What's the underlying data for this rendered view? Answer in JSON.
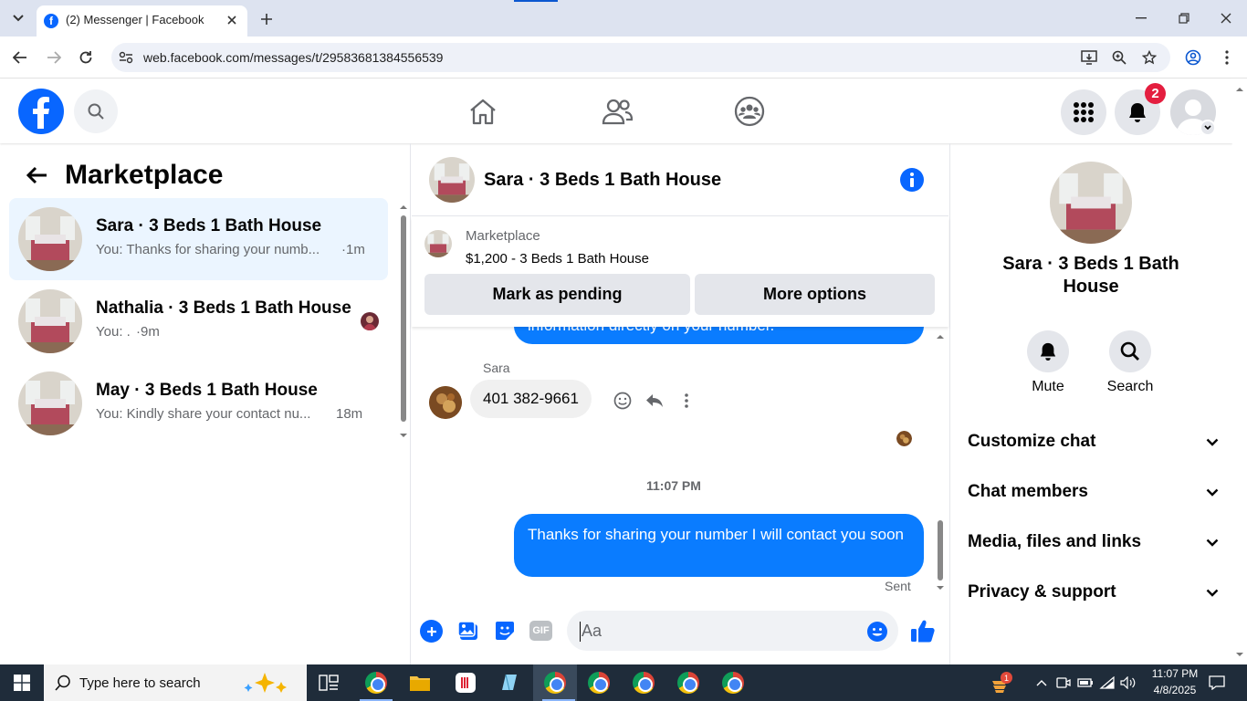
{
  "browser": {
    "tab_title": "(2) Messenger | Facebook",
    "url": "web.facebook.com/messages/t/29583681384556539"
  },
  "header": {
    "notification_count": "2"
  },
  "left": {
    "title": "Marketplace",
    "conversations": [
      {
        "name": "Sara · 3 Beds 1 Bath House",
        "preview": "You: Thanks for sharing your numb...",
        "time": "·1m"
      },
      {
        "name": "Nathalia · 3 Beds 1 Bath House",
        "preview": "You: .",
        "time": "·9m"
      },
      {
        "name": "May · 3 Beds 1 Bath House",
        "preview": "You: Kindly share your contact nu...",
        "time": "18m"
      }
    ]
  },
  "chat": {
    "title": "Sara · 3 Beds 1 Bath House",
    "listing_source": "Marketplace",
    "listing_title": "$1,200 - 3 Beds 1 Bath House",
    "mark_pending": "Mark as pending",
    "more_options": "More options",
    "partial_message": "information directly on your number.",
    "sender": "Sara",
    "phone_message": "401 382-9661",
    "timestamp": "11:07 PM",
    "my_message": "Thanks for sharing your number I will contact you soon",
    "status": "Sent",
    "input_placeholder": "Aa",
    "gif_label": "GIF"
  },
  "right": {
    "name": "Sara · 3 Beds 1 Bath House",
    "mute": "Mute",
    "search": "Search",
    "sections": [
      "Customize chat",
      "Chat members",
      "Media, files and links",
      "Privacy & support"
    ]
  },
  "taskbar": {
    "search_placeholder": "Type here to search",
    "time": "11:07 PM",
    "date": "4/8/2025",
    "weather_badge": "1"
  },
  "colors": {
    "brand": "#0866ff",
    "bubble": "#0a7cff",
    "selected": "#ebf5ff"
  }
}
